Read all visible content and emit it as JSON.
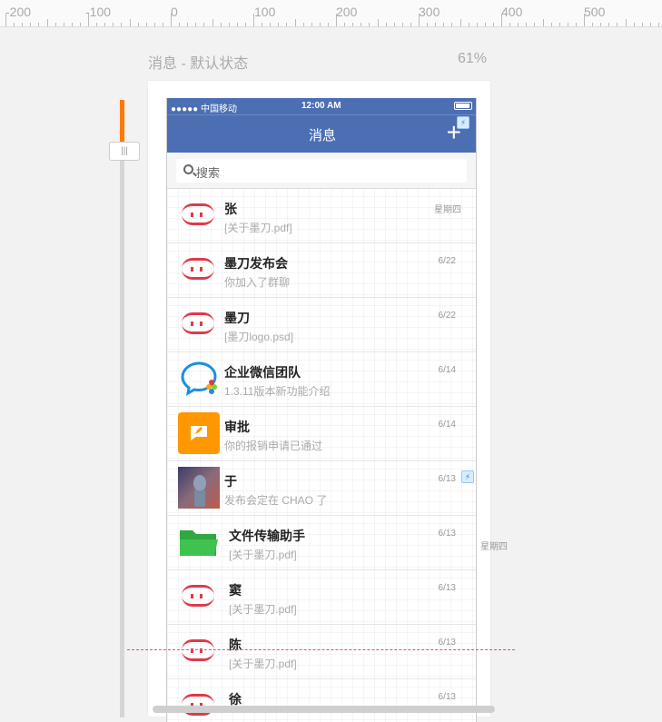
{
  "ruler": {
    "labels": [
      "-200",
      "-100",
      "0",
      "100",
      "200",
      "300",
      "400",
      "500"
    ]
  },
  "canvas": {
    "title": "消息 - 默认状态",
    "zoom": "61%"
  },
  "statusbar": {
    "carrier": "●●●●● 中国移动",
    "time": "12:00 AM"
  },
  "navbar": {
    "title": "消息",
    "plus": "+"
  },
  "search": {
    "placeholder": "搜索"
  },
  "messages": [
    {
      "name": "张",
      "msg": "[关于墨刀.pdf]",
      "date": "星期四",
      "avatar": "bot-icon"
    },
    {
      "name": "墨刀发布会",
      "msg": "你加入了群聊",
      "date": "6/22",
      "avatar": "bot-icon"
    },
    {
      "name": "墨刀",
      "msg": "[墨刀logo.psd]",
      "date": "6/22",
      "avatar": "bot-icon"
    },
    {
      "name": "企业微信团队",
      "msg": "1.3.11版本新功能介绍",
      "date": "6/14",
      "avatar": "wechat-work-icon"
    },
    {
      "name": "审批",
      "msg": "你的报销申请已通过",
      "date": "6/14",
      "avatar": "approval-icon"
    },
    {
      "name": "于",
      "msg": "发布会定在 CHAO 了",
      "date": "6/13",
      "avatar": "photo-avatar"
    },
    {
      "name": "文件传输助手",
      "msg": "[关于墨刀.pdf]",
      "date": "6/13",
      "avatar": "folder-icon"
    },
    {
      "name": "窦",
      "msg": "[关于墨刀.pdf]",
      "date": "6/13",
      "avatar": "bot-icon"
    },
    {
      "name": "陈",
      "msg": "[关于墨刀.pdf]",
      "date": "6/13",
      "avatar": "bot-icon"
    },
    {
      "name": "徐",
      "msg": "",
      "date": "6/13",
      "avatar": "bot-icon"
    }
  ],
  "side_date": "星期四",
  "bolt": "⚡"
}
